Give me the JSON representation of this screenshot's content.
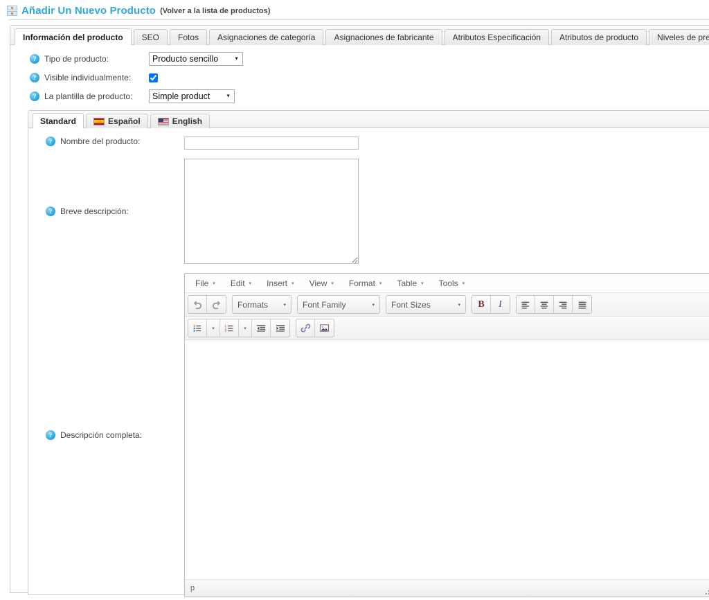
{
  "header": {
    "icon": "add-product-icon",
    "title": "Añadir Un Nuevo Producto",
    "back_link": "(Volver a la lista de productos)"
  },
  "main_tabs": [
    {
      "label": "Información del producto",
      "active": true
    },
    {
      "label": "SEO",
      "active": false
    },
    {
      "label": "Fotos",
      "active": false
    },
    {
      "label": "Asignaciones de categoría",
      "active": false
    },
    {
      "label": "Asignaciones de fabricante",
      "active": false
    },
    {
      "label": "Atributos Especificación",
      "active": false
    },
    {
      "label": "Atributos de producto",
      "active": false
    },
    {
      "label": "Niveles de precio",
      "active": false
    }
  ],
  "form": {
    "product_type": {
      "label": "Tipo de producto:",
      "value": "Producto sencillo",
      "options": [
        "Producto sencillo"
      ]
    },
    "visible_individually": {
      "label": "Visible individualmente:",
      "checked": true
    },
    "product_template": {
      "label": "La plantilla de producto:",
      "value": "Simple product",
      "options": [
        "Simple product"
      ]
    }
  },
  "lang_tabs": [
    {
      "label": "Standard",
      "flag": "none",
      "active": true
    },
    {
      "label": "Español",
      "flag": "flag-spain-icon",
      "active": false
    },
    {
      "label": "English",
      "flag": "flag-usa-icon",
      "active": false
    }
  ],
  "lang_form": {
    "product_name": {
      "label": "Nombre del producto:",
      "value": "",
      "placeholder": ""
    },
    "short_description": {
      "label": "Breve descripción:",
      "value": "",
      "placeholder": ""
    },
    "full_description": {
      "label": "Descripción completa:"
    }
  },
  "editor": {
    "menubar": [
      {
        "label": "File",
        "caret": "▾"
      },
      {
        "label": "Edit",
        "caret": "▾"
      },
      {
        "label": "Insert",
        "caret": "▾"
      },
      {
        "label": "View",
        "caret": "▾"
      },
      {
        "label": "Format",
        "caret": "▾"
      },
      {
        "label": "Table",
        "caret": "▾"
      },
      {
        "label": "Tools",
        "caret": "▾"
      }
    ],
    "listboxes": {
      "formats": "Formats",
      "font_family": "Font Family",
      "font_sizes": "Font Sizes"
    },
    "buttons": {
      "undo": "undo-icon",
      "redo": "redo-icon",
      "bold": "B",
      "italic": "I",
      "align_left": "align-left-icon",
      "align_center": "align-center-icon",
      "align_right": "align-right-icon",
      "align_justify": "align-justify-icon",
      "bullist": "bullet-list-icon",
      "numlist": "numbered-list-icon",
      "outdent": "outdent-icon",
      "indent": "indent-icon",
      "link": "link-icon",
      "image": "image-icon"
    },
    "content": "",
    "statusbar_path": "p",
    "caret": "▾"
  },
  "colors": {
    "title_blue": "#2fa7e0",
    "help_icon_blue": "#35aee4",
    "panel_border": "#cccccc",
    "active_tab_bg": "#ffffff",
    "input_border_focus": "#a9c8de"
  }
}
